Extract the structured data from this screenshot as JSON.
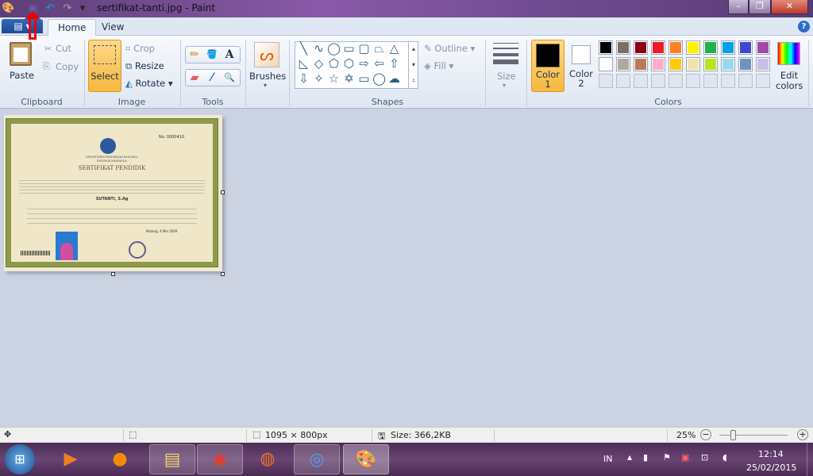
{
  "window": {
    "title": "sertifikat-tanti.jpg - Paint",
    "minimize": "–",
    "restore": "❐",
    "close": "✕"
  },
  "quick_access": {
    "save_icon": "floppy",
    "undo_icon": "undo",
    "redo_icon": "redo",
    "customize": "▾"
  },
  "tabs": {
    "file": "▤ ▾",
    "home": "Home",
    "view": "View",
    "help": "?"
  },
  "clipboard": {
    "paste": "Paste",
    "cut": "Cut",
    "copy": "Copy",
    "group": "Clipboard"
  },
  "image": {
    "select": "Select",
    "crop": "Crop",
    "resize": "Resize",
    "rotate": "Rotate",
    "group": "Image"
  },
  "tools": {
    "group": "Tools",
    "pencil": "✏",
    "fill": "🪣",
    "text": "A",
    "eraser": "▰",
    "picker": "⁄",
    "magnifier": "🔍"
  },
  "brushes": {
    "label": "Brushes"
  },
  "shapes": {
    "group": "Shapes",
    "items": [
      "╲",
      "∿",
      "◯",
      "▭",
      "▢",
      "⏢",
      "△",
      "◺",
      "◇",
      "⬠",
      "⬡",
      "⇨",
      "⇦",
      "⇧",
      "⇩",
      "✧",
      "☆",
      "✡",
      "▭",
      "◯",
      "☁"
    ],
    "outline": "Outline",
    "fill": "Fill"
  },
  "size": {
    "label": "Size"
  },
  "colors": {
    "group": "Colors",
    "color1": "Color 1",
    "color2": "Color 2",
    "edit": "Edit colors",
    "color1_value": "#000000",
    "color2_value": "#ffffff",
    "palette_row1": [
      "#000000",
      "#7a6f66",
      "#880015",
      "#ed1c24",
      "#ff7f27",
      "#fff200",
      "#22b14c",
      "#00a2e8",
      "#3f48cc",
      "#a349a4"
    ],
    "palette_row2": [
      "#ffffff",
      "#b0a89f",
      "#b97a57",
      "#ffaec9",
      "#ffc90e",
      "#efe4b0",
      "#b5e61d",
      "#99d9ea",
      "#7092be",
      "#c8bfe7"
    ]
  },
  "certificate": {
    "number": "No. 0000410",
    "dept": "DEPARTEMEN PENDIDIKAN NASIONAL",
    "republic": "REPUBLIK INDONESIA",
    "heading": "SERTIFIKAT PENDIDIK",
    "name": "SUTANTI, S.Ag",
    "place_date": "Malang, 4 Mei 2009"
  },
  "status": {
    "dimensions": "1095 × 800px",
    "size": "Size: 366,2KB",
    "zoom": "25%",
    "zoom_level": 25
  },
  "taskbar": {
    "language": "IN",
    "time": "12:14",
    "date": "25/02/2015"
  }
}
